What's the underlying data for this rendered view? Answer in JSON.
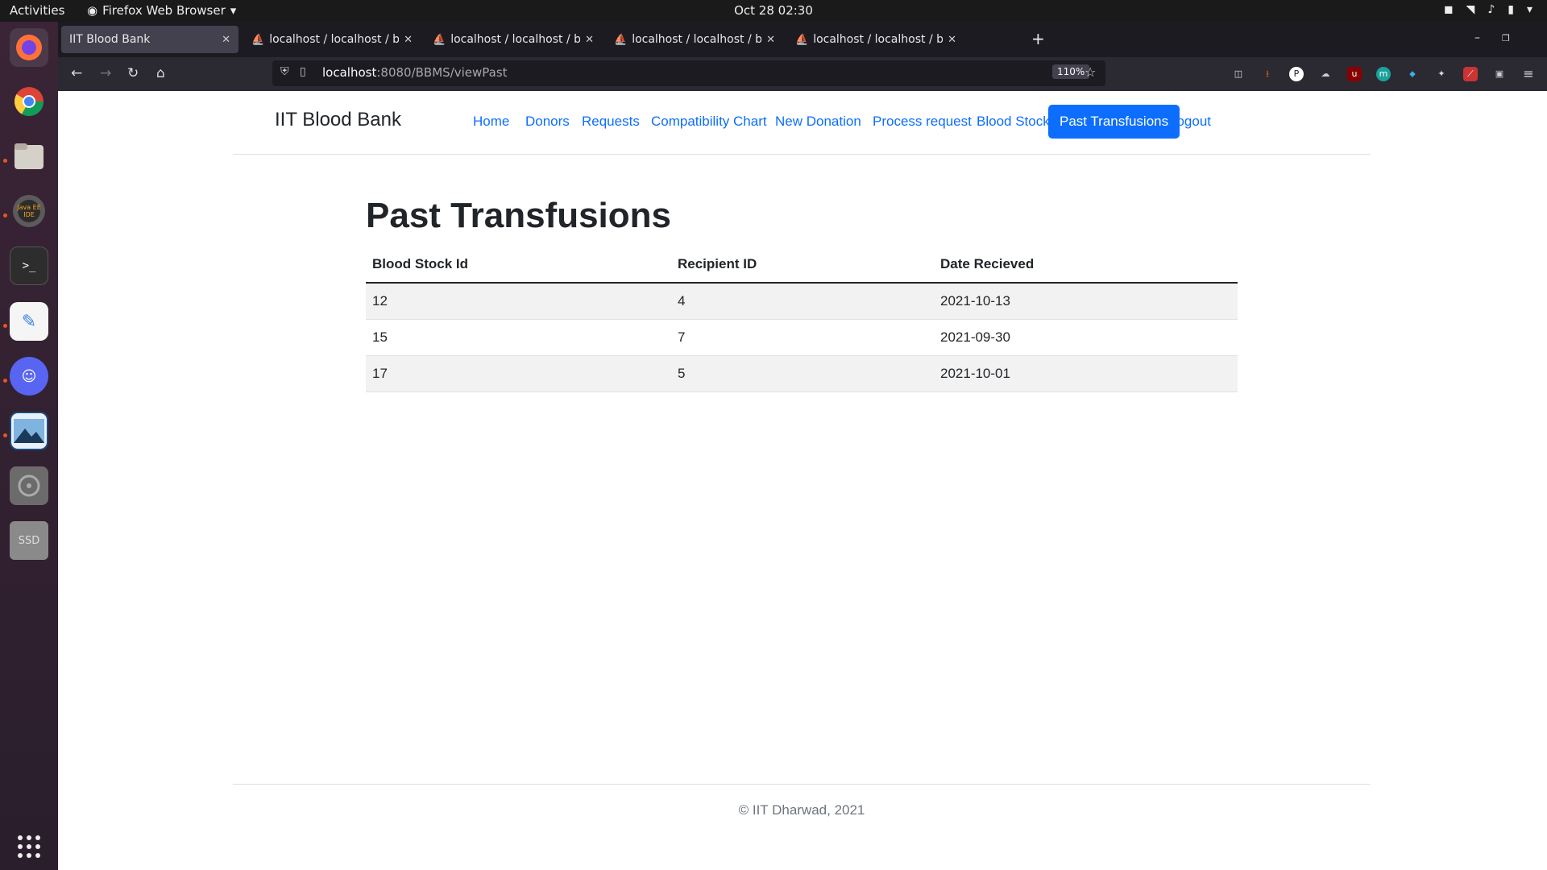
{
  "system": {
    "activities": "Activities",
    "app_name": "Firefox Web Browser",
    "clock": "Oct 28  02:30"
  },
  "dock": {
    "items": [
      "Firefox",
      "Chrome",
      "Files",
      "Java EE IDE",
      "Terminal",
      "Text Editor",
      "Discord",
      "Image Viewer",
      "Disks",
      "SSD"
    ]
  },
  "browser": {
    "tabs": [
      {
        "title": "IIT Blood Bank",
        "active": true
      },
      {
        "title": "localhost / localhost / blo",
        "active": false
      },
      {
        "title": "localhost / localhost / blo",
        "active": false
      },
      {
        "title": "localhost / localhost / blo",
        "active": false
      },
      {
        "title": "localhost / localhost / blo",
        "active": false
      }
    ],
    "url_host": "localhost",
    "url_rest": ":8080/BBMS/viewPast",
    "zoom": "110%"
  },
  "site": {
    "brand": "IIT Blood Bank",
    "nav": [
      {
        "label": "Home",
        "active": false
      },
      {
        "label": "Donors",
        "active": false
      },
      {
        "label": "Requests",
        "active": false
      },
      {
        "label": "Compatibility Chart",
        "active": false
      },
      {
        "label": "New Donation",
        "active": false
      },
      {
        "label": "Process request",
        "active": false
      },
      {
        "label": "Blood Stock",
        "active": false
      },
      {
        "label": "Past Transfusions",
        "active": true
      },
      {
        "label": "Logout",
        "active": false
      }
    ],
    "page_title": "Past Transfusions",
    "table": {
      "headers": [
        "Blood Stock Id",
        "Recipient ID",
        "Date Recieved"
      ],
      "rows": [
        [
          "12",
          "4",
          "2021-10-13"
        ],
        [
          "15",
          "7",
          "2021-09-30"
        ],
        [
          "17",
          "5",
          "2021-10-01"
        ]
      ]
    },
    "footer": "© IIT Dharwad, 2021"
  }
}
